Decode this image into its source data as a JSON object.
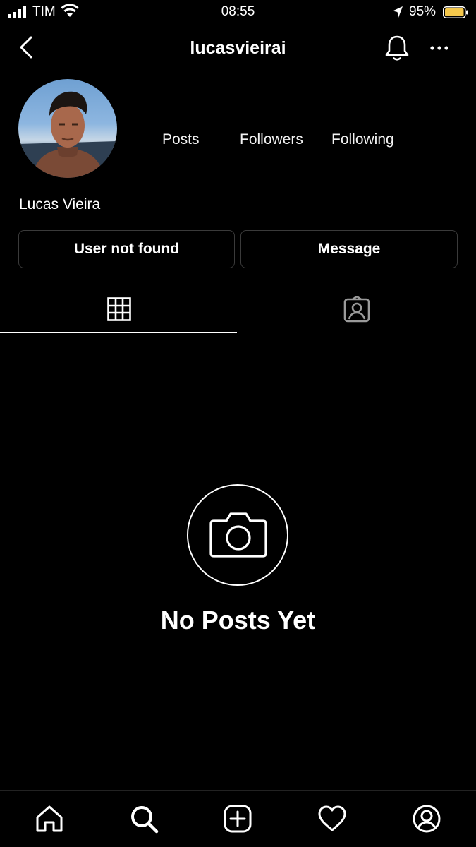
{
  "status_bar": {
    "carrier": "TIM",
    "time": "08:55",
    "battery": "95%"
  },
  "header": {
    "username": "lucasvieirai"
  },
  "profile": {
    "display_name": "Lucas Vieira",
    "stats": {
      "posts_label": "Posts",
      "followers_label": "Followers",
      "following_label": "Following"
    },
    "primary_button": "User not found",
    "secondary_button": "Message"
  },
  "tabs": [
    {
      "icon": "grid-icon",
      "active": true
    },
    {
      "icon": "tagged-icon",
      "active": false
    }
  ],
  "empty_state": {
    "icon": "camera-icon",
    "title": "No Posts Yet"
  },
  "bottom_nav": [
    "home-icon",
    "search-icon",
    "add-icon",
    "heart-icon",
    "profile-icon"
  ],
  "colors": {
    "background": "#000000",
    "text": "#ffffff",
    "border": "#3a3a3a",
    "battery": "#f5c84c"
  }
}
